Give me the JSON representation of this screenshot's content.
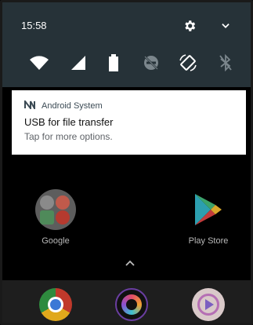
{
  "status": {
    "time": "15:58"
  },
  "header_icons": [
    "gear-icon",
    "chevron-down-icon"
  ],
  "quick_settings": [
    "wifi-icon",
    "cellular-signal-icon",
    "battery-icon",
    "do-not-disturb-off-icon",
    "auto-rotate-icon",
    "bluetooth-off-icon"
  ],
  "notification": {
    "app_name": "Android System",
    "title": "USB for file transfer",
    "text": "Tap for more options."
  },
  "home": {
    "apps": [
      {
        "label": "Google"
      },
      {
        "label": "Play Store"
      }
    ],
    "dock": [
      "chrome-icon",
      "camera-app-icon",
      "video-app-icon"
    ]
  },
  "colors": {
    "shade_bg": "#263238",
    "notif_bg": "#ffffff",
    "home_bg": "#000000",
    "dock_bg": "#1e1e1e"
  }
}
